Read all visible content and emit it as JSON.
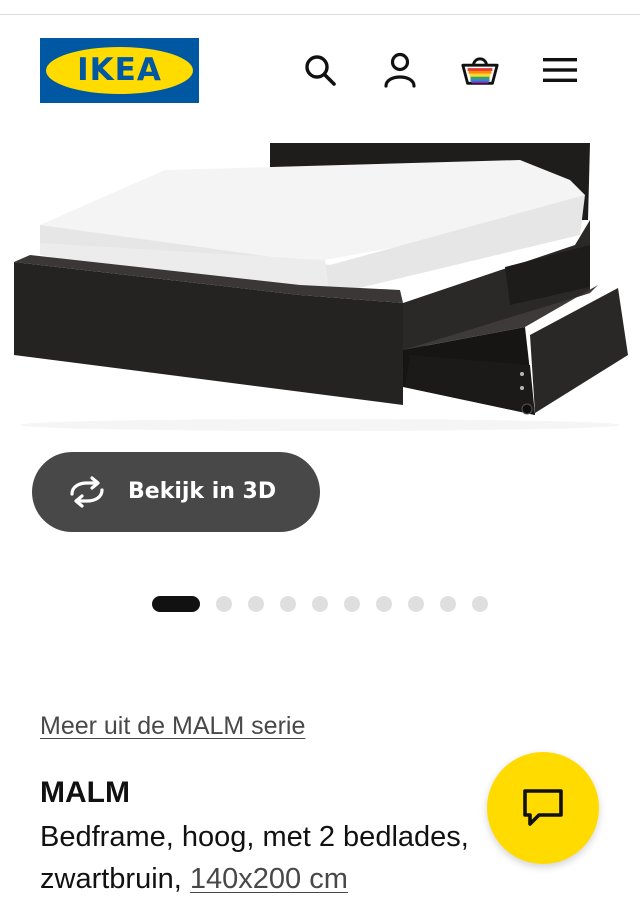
{
  "header": {
    "logo_text": "IKEA",
    "icons": [
      "search-icon",
      "account-icon",
      "cart-icon",
      "menu-icon"
    ],
    "brand_blue": "#0058a3",
    "brand_yellow": "#ffdb00"
  },
  "gallery": {
    "view_3d_label": "Bekijk in 3D",
    "total_images": 10,
    "active_index": 0
  },
  "product": {
    "series_link": "Meer uit de MALM serie",
    "name": "MALM",
    "description": "Bedframe, hoog, met 2 bedlades,",
    "color": "zwartbruin,",
    "size": "140x200 cm"
  },
  "chat": {
    "icon": "chat-icon",
    "color": "#ffdb00"
  }
}
